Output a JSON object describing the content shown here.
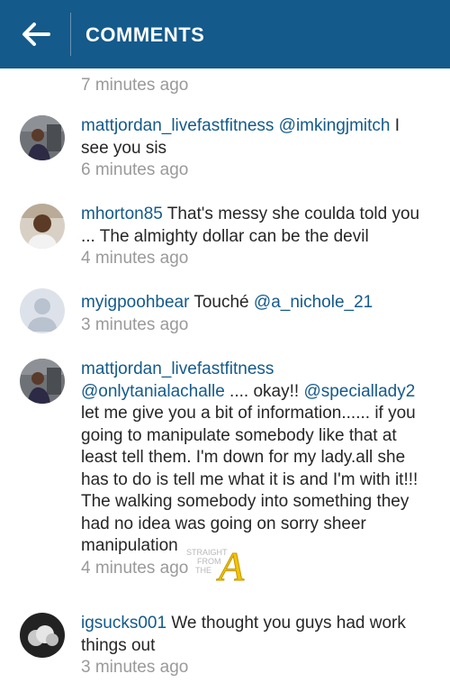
{
  "header": {
    "title": "COMMENTS"
  },
  "first_time": "7 minutes ago",
  "comments": [
    {
      "user": "mattjordan_livefastfitness",
      "m1": "@imkingjmitch",
      "t1": " I see you sis",
      "time": "6 minutes ago"
    },
    {
      "user": "mhorton85",
      "t1": " That's messy she coulda told you ... The almighty dollar can be the devil",
      "time": "4 minutes ago"
    },
    {
      "user": "myigpoohbear",
      "t1": " Touché ",
      "m1": "@a_nichole_21",
      "time": "3 minutes ago"
    },
    {
      "user": "mattjordan_livefastfitness",
      "m1": "@onlytanialachalle",
      "t1": " .... okay!! ",
      "m2": "@speciallady2",
      "t2": " let me give you a bit of information...... if you going to manipulate somebody like that at least tell them. I'm down for my lady.all she has to do is tell me what it is and I'm with it!!! The walking somebody into something they had no idea was going on sorry sheer manipulation",
      "time": "4 minutes ago"
    },
    {
      "user": "igsucks001",
      "t1": " We thought you guys had work things out",
      "time": "3 minutes ago"
    }
  ],
  "watermark": {
    "line1": "STRAIGHT",
    "line2": "FROM",
    "line3": "THE",
    "letter": "A"
  },
  "colors": {
    "header_bg": "#145a8b",
    "link": "#145a8b",
    "timestamp": "#9a9a9a"
  }
}
